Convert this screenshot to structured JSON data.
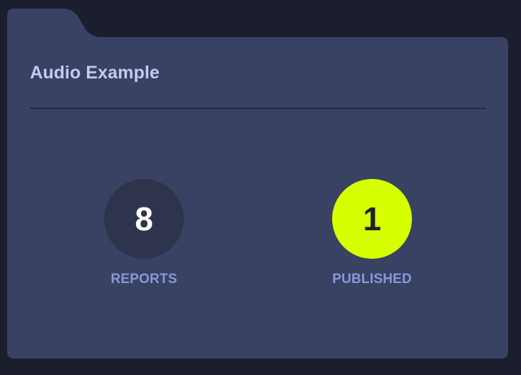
{
  "card": {
    "title": "Audio Example"
  },
  "stats": [
    {
      "value": "8",
      "label": "REPORTS"
    },
    {
      "value": "1",
      "label": "PUBLISHED"
    }
  ],
  "colors": {
    "background": "#1b1e2d",
    "card": "#394263",
    "title": "#c3cbf3",
    "reports_circle": "#2f344d",
    "published_circle": "#d6ff00",
    "label": "#8a98d6"
  }
}
